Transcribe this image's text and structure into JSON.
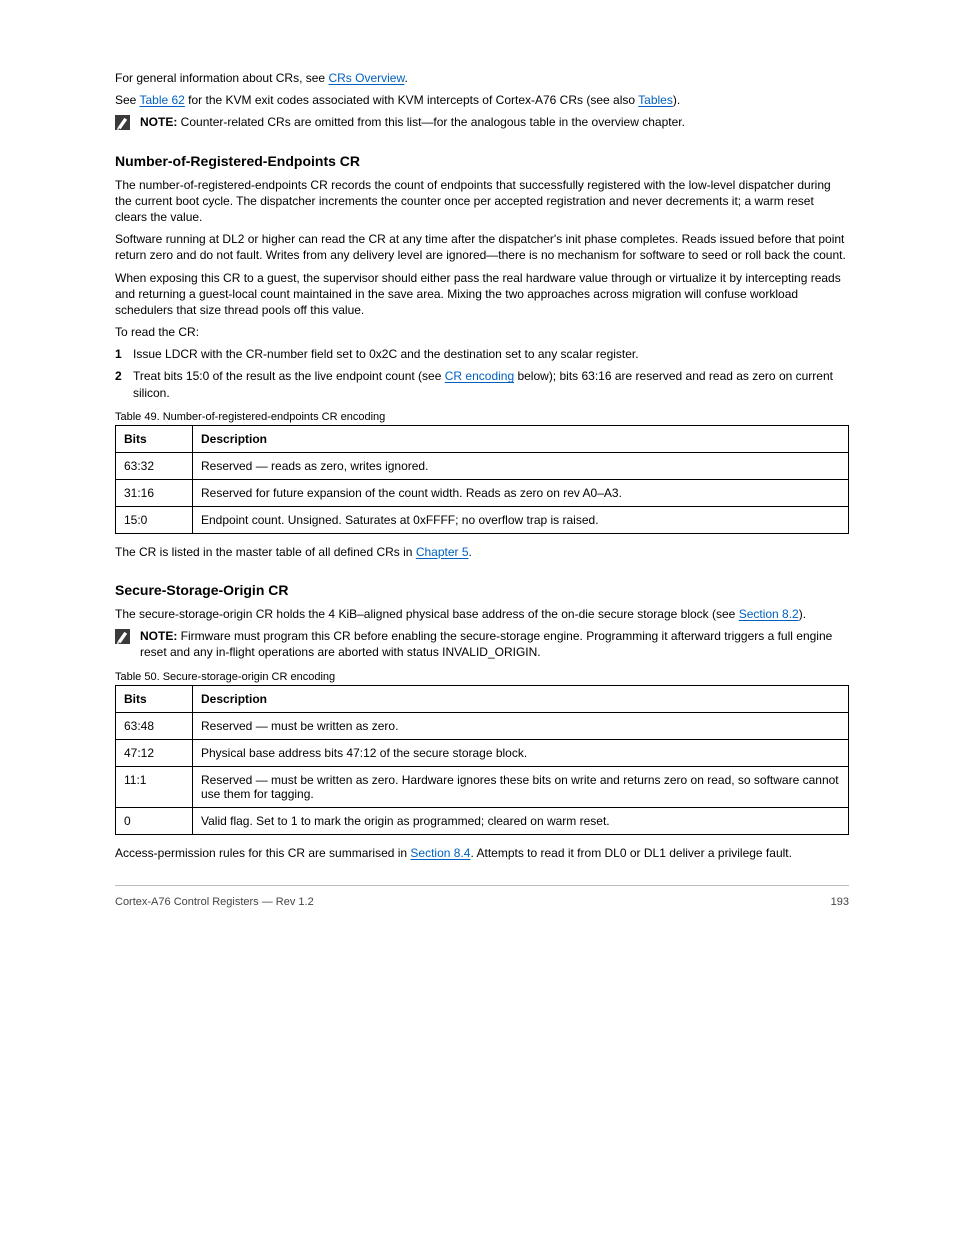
{
  "intro": {
    "p1_prefix": "For general information about CRs, see ",
    "p1_link": "CRs Overview",
    "p1_suffix": "."
  },
  "kvm": {
    "p_prefix": "See ",
    "p_link": "Table 62",
    "p_mid": " for the KVM exit codes associated with KVM intercepts of Cortex-A76 CRs (see also ",
    "p_link2": "Tables",
    "p_suffix": ").",
    "note_label": "NOTE:",
    "note_text": " Counter-related CRs are omitted from this list—for the analogous table in the overview chapter."
  },
  "nre": {
    "heading": "Number-of-Registered-Endpoints CR",
    "p1": "The number-of-registered-endpoints CR records the count of endpoints that successfully registered with the low-level dispatcher during the current boot cycle. The dispatcher increments the counter once per accepted registration and never decrements it; a warm reset clears the value.",
    "p2": "Software running at DL2 or higher can read the CR at any time after the dispatcher's init phase completes. Reads issued before that point return zero and do not fault. Writes from any delivery level are ignored—there is no mechanism for software to seed or roll back the count.",
    "p3": "When exposing this CR to a guest, the supervisor should either pass the real hardware value through or virtualize it by intercepting reads and returning a guest-local count maintained in the save area. Mixing the two approaches across migration will confuse workload schedulers that size thread pools off this value.",
    "p4": "To read the CR:",
    "step1_num": "1",
    "step1_text": "Issue LDCR with the CR-number field set to 0x2C and the destination set to any scalar register.",
    "step2_num": "2",
    "step2_a": "Treat bits 15:0 of the result as the live endpoint count (see ",
    "step2_link": "CR encoding",
    "step2_b": " below); bits 63:16 are reserved and read as zero on current silicon.",
    "table_title": "Table 49. Number-of-registered-endpoints CR encoding",
    "headers": {
      "bits": "Bits",
      "desc": "Description"
    },
    "rows": [
      {
        "bits": "63:32",
        "desc": "Reserved — reads as zero, writes ignored."
      },
      {
        "bits": "31:16",
        "desc": "Reserved for future expansion of the count width. Reads as zero on rev A0–A3."
      },
      {
        "bits": "15:0",
        "desc": "Endpoint count. Unsigned. Saturates at 0xFFFF; no overflow trap is raised."
      }
    ],
    "post_a": "The CR is listed in the master table of all defined CRs in ",
    "post_link": "Chapter 5",
    "post_b": "."
  },
  "sso": {
    "heading": "Secure-Storage-Origin CR",
    "p_a": "The secure-storage-origin CR holds the 4 KiB–aligned physical base address of the on-die secure storage block (see ",
    "p_link": "Section 8.2",
    "p_b": ").",
    "note_label": "NOTE:",
    "note_text": " Firmware must program this CR before enabling the secure-storage engine. Programming it afterward triggers a full engine reset and any in-flight operations are aborted with status INVALID_ORIGIN.",
    "table_title": "Table 50. Secure-storage-origin CR encoding",
    "headers": {
      "bits": "Bits",
      "desc": "Description"
    },
    "rows": [
      {
        "bits": "63:48",
        "desc": "Reserved — must be written as zero."
      },
      {
        "bits": "47:12",
        "desc": "Physical base address bits 47:12 of the secure storage block."
      },
      {
        "bits": "11:1",
        "desc": "Reserved — must be written as zero. Hardware ignores these bits on write and returns zero on read, so software cannot use them for tagging."
      },
      {
        "bits": "0",
        "desc": "Valid flag. Set to 1 to mark the origin as programmed; cleared on warm reset."
      }
    ],
    "post_a": "Access-permission rules for this CR are summarised in ",
    "post_link": "Section 8.4",
    "post_b": ". Attempts to read it from DL0 or DL1 deliver a privilege fault."
  },
  "footer": {
    "left": "Cortex-A76 Control Registers — Rev 1.2",
    "right": "193"
  }
}
